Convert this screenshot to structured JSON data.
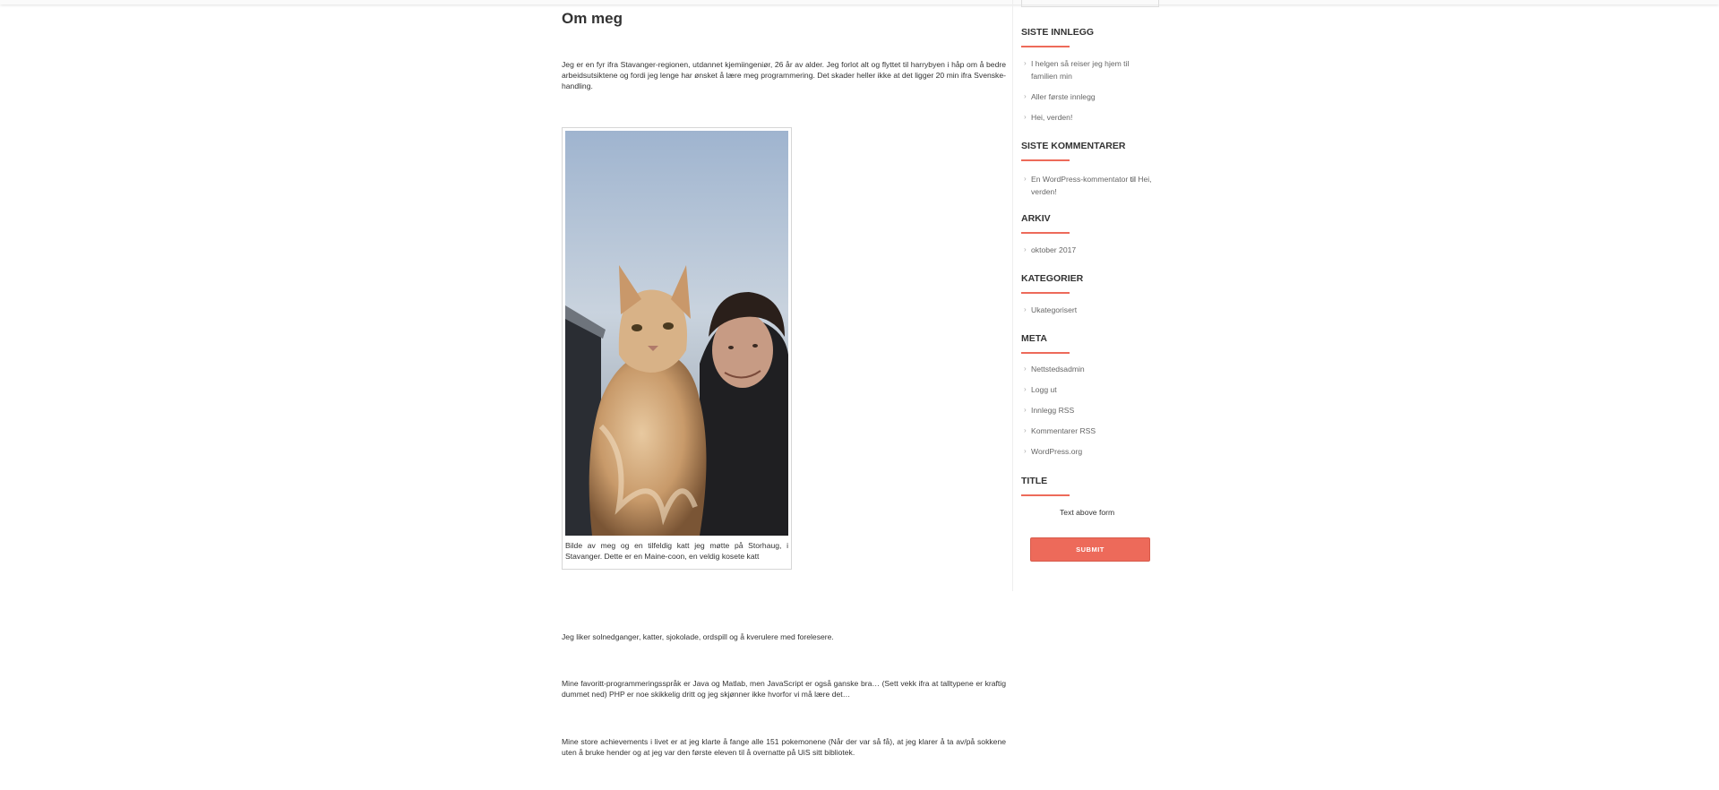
{
  "page": {
    "title": "Om meg",
    "intro": "Jeg er en fyr ifra Stavanger-regionen, utdannet kjemiingeniør, 26 år av alder. Jeg forlot alt og flyttet til harrybyen i håp om å bedre arbeidsutsiktene og fordi jeg lenge har ønsket å lære meg programmering. Det skader heller ikke at det ligger 20 min ifra Svenske-handling.",
    "figure_caption": "Bilde av meg og en tilfeldig katt jeg møtte på Storhaug, i Stavanger. Dette er en Maine-coon, en veldig kosete katt",
    "likes": "Jeg liker solnedganger, katter, sjokolade, ordspill og å kverulere med forelesere.",
    "languages": "Mine favoritt-programmeringsspråk er Java og Matlab, men JavaScript er også ganske bra… (Sett vekk ifra at talltypene er kraftig dummet ned) PHP er noe skikkelig dritt og jeg skjønner ikke hvorfor vi må lære det…",
    "achievements": "Mine store achievements i livet er at jeg klarte å fange alle 151 pokemonene (Når der var så få), at jeg klarer å ta av/på sokkene uten å bruke hender og at jeg var den første eleven til å overnatte på UiS sitt bibliotek."
  },
  "sidebar": {
    "recent_posts": {
      "title": "SISTE INNLEGG",
      "items": [
        "I helgen så reiser jeg hjem til familien min",
        "Aller første innlegg",
        "Hei, verden!"
      ]
    },
    "recent_comments": {
      "title": "SISTE KOMMENTARER",
      "author": "En WordPress-kommentator",
      "connector": "til",
      "post": "Hei, verden!"
    },
    "archive": {
      "title": "ARKIV",
      "items": [
        "oktober 2017"
      ]
    },
    "categories": {
      "title": "KATEGORIER",
      "items": [
        "Ukategorisert"
      ]
    },
    "meta": {
      "title": "META",
      "items": [
        "Nettstedsadmin",
        "Logg ut",
        "Innlegg RSS",
        "Kommentarer RSS",
        "WordPress.org"
      ]
    },
    "form": {
      "title": "TITLE",
      "text": "Text above form",
      "submit": "SUBMIT"
    }
  },
  "colors": {
    "accent": "#ed6a5a",
    "text": "#333333",
    "muted": "#666666"
  }
}
